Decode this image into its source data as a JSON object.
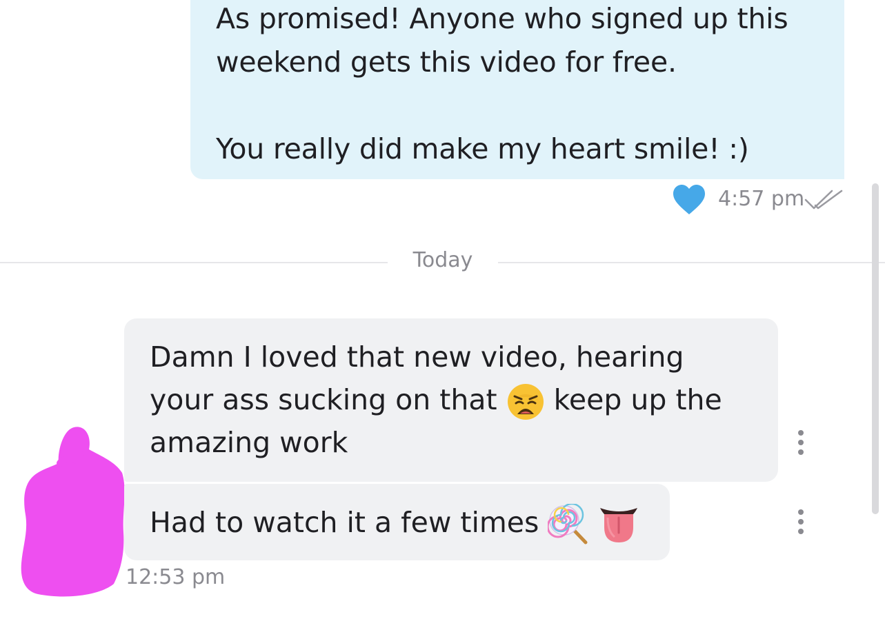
{
  "outgoing": {
    "lines": [
      "As promised! Anyone who signed up this",
      "weekend gets this video for free.",
      "",
      "You really did make my heart smile! :)"
    ],
    "time": "4:57 pm",
    "liked": true,
    "status": "read"
  },
  "divider": {
    "label": "Today"
  },
  "incoming": {
    "message1": {
      "line1": "Damn I loved that new video, hearing",
      "line2_before": "your ass sucking on that",
      "line2_emoji": "weary-face-emoji",
      "line2_after": "keep up the",
      "line3": "amazing work"
    },
    "message2": {
      "text": "Had to watch it a few times",
      "emojis": [
        "lollipop-emoji",
        "tongue-emoji"
      ]
    },
    "time": "12:53 pm"
  },
  "colors": {
    "outgoing_bubble": "#e1f3fa",
    "incoming_bubble": "#f0f1f3",
    "heart": "#46a8e8",
    "avatar_redaction": "#ee4ff0"
  },
  "icons": {
    "like": "heart-icon",
    "read": "double-check-icon",
    "more": "more-vertical-icon"
  }
}
